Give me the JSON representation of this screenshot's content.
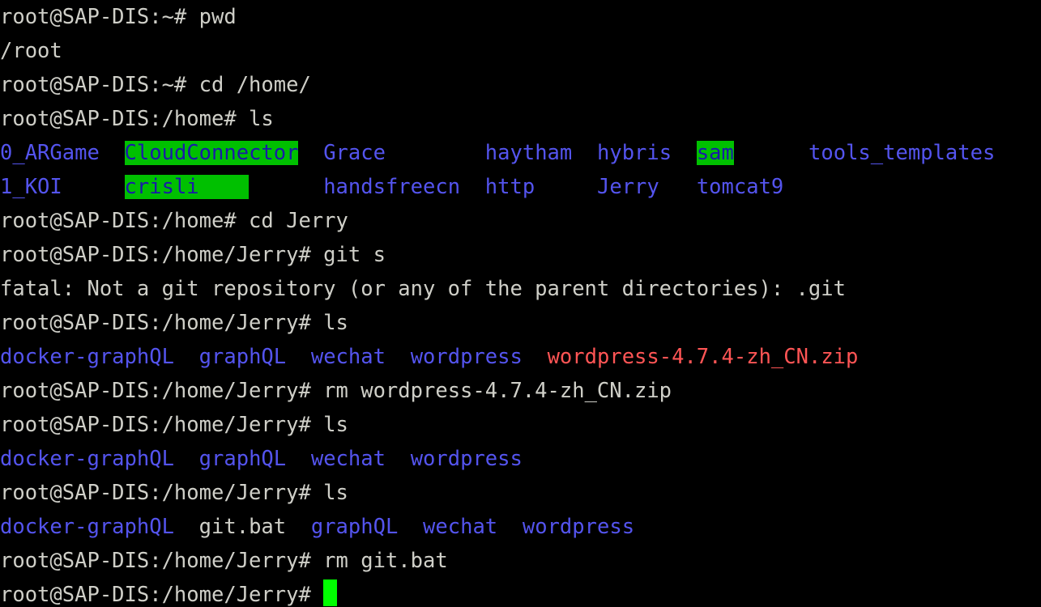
{
  "terminal": {
    "app": "bash-terminal",
    "columns": 81,
    "rows": 18,
    "colors": {
      "background": "#000000",
      "default_text": "#cfcfc8",
      "directory": "#5454ee",
      "archive": "#ff5555",
      "sticky_other_writable_bg": "#00c000",
      "sticky_other_writable_fg": "#1a1aa8",
      "cursor": "#00ff00"
    },
    "prompts": {
      "home": "root@SAP-DIS:~# ",
      "home_dir": "root@SAP-DIS:/home# ",
      "jerry_dir": "root@SAP-DIS:/home/Jerry# "
    },
    "lines": [
      {
        "id": "line-1",
        "kind": "prompt-command",
        "prompt": "root@SAP-DIS:~# ",
        "command": "pwd"
      },
      {
        "id": "line-2",
        "kind": "output",
        "text": "/root"
      },
      {
        "id": "line-3",
        "kind": "prompt-command",
        "prompt": "root@SAP-DIS:~# ",
        "command": "cd /home/"
      },
      {
        "id": "line-4",
        "kind": "prompt-command",
        "prompt": "root@SAP-DIS:/home# ",
        "command": "ls"
      },
      {
        "id": "line-5",
        "kind": "ls-row",
        "entries": [
          {
            "name": "0_ARGame",
            "type": "directory",
            "pad": 2
          },
          {
            "name": "CloudConnector",
            "type": "sticky",
            "pad": 2
          },
          {
            "name": "Grace",
            "type": "directory",
            "pad": 8
          },
          {
            "name": "haytham",
            "type": "directory",
            "pad": 2
          },
          {
            "name": "hybris",
            "type": "directory",
            "pad": 2
          },
          {
            "name": "sam",
            "type": "sticky",
            "pad": 6
          },
          {
            "name": "tools_templates",
            "type": "directory",
            "pad": 0
          }
        ]
      },
      {
        "id": "line-6",
        "kind": "ls-row",
        "entries": [
          {
            "name": "1_KOI",
            "type": "directory",
            "pad": 5
          },
          {
            "name": "crisli",
            "type": "sticky",
            "pad": 10,
            "highlight_pad": 4
          },
          {
            "name": "handsfreecn",
            "type": "directory",
            "pad": 2
          },
          {
            "name": "http",
            "type": "directory",
            "pad": 5
          },
          {
            "name": "Jerry",
            "type": "directory",
            "pad": 3
          },
          {
            "name": "tomcat9",
            "type": "directory",
            "pad": 0
          }
        ]
      },
      {
        "id": "line-7",
        "kind": "prompt-command",
        "prompt": "root@SAP-DIS:/home# ",
        "command": "cd Jerry"
      },
      {
        "id": "line-8",
        "kind": "prompt-command",
        "prompt": "root@SAP-DIS:/home/Jerry# ",
        "command": "git s"
      },
      {
        "id": "line-9",
        "kind": "output",
        "text": "fatal: Not a git repository (or any of the parent directories): .git"
      },
      {
        "id": "line-10",
        "kind": "prompt-command",
        "prompt": "root@SAP-DIS:/home/Jerry# ",
        "command": "ls"
      },
      {
        "id": "line-11",
        "kind": "ls-row",
        "entries": [
          {
            "name": "docker-graphQL",
            "type": "directory",
            "pad": 2
          },
          {
            "name": "graphQL",
            "type": "directory",
            "pad": 2
          },
          {
            "name": "wechat",
            "type": "directory",
            "pad": 2
          },
          {
            "name": "wordpress",
            "type": "directory",
            "pad": 2
          },
          {
            "name": "wordpress-4.7.4-zh_CN.zip",
            "type": "archive",
            "pad": 0
          }
        ]
      },
      {
        "id": "line-12",
        "kind": "prompt-command",
        "prompt": "root@SAP-DIS:/home/Jerry# ",
        "command": "rm wordpress-4.7.4-zh_CN.zip"
      },
      {
        "id": "line-13",
        "kind": "prompt-command",
        "prompt": "root@SAP-DIS:/home/Jerry# ",
        "command": "ls"
      },
      {
        "id": "line-14",
        "kind": "ls-row",
        "entries": [
          {
            "name": "docker-graphQL",
            "type": "directory",
            "pad": 2
          },
          {
            "name": "graphQL",
            "type": "directory",
            "pad": 2
          },
          {
            "name": "wechat",
            "type": "directory",
            "pad": 2
          },
          {
            "name": "wordpress",
            "type": "directory",
            "pad": 0
          }
        ]
      },
      {
        "id": "line-15",
        "kind": "prompt-command",
        "prompt": "root@SAP-DIS:/home/Jerry# ",
        "command": "ls"
      },
      {
        "id": "line-16",
        "kind": "ls-row",
        "entries": [
          {
            "name": "docker-graphQL",
            "type": "directory",
            "pad": 2
          },
          {
            "name": "git.bat",
            "type": "file",
            "pad": 2
          },
          {
            "name": "graphQL",
            "type": "directory",
            "pad": 2
          },
          {
            "name": "wechat",
            "type": "directory",
            "pad": 2
          },
          {
            "name": "wordpress",
            "type": "directory",
            "pad": 0
          }
        ]
      },
      {
        "id": "line-17",
        "kind": "prompt-command",
        "prompt": "root@SAP-DIS:/home/Jerry# ",
        "command": "rm git.bat"
      },
      {
        "id": "line-18",
        "kind": "prompt-cursor",
        "prompt": "root@SAP-DIS:/home/Jerry# ",
        "command": ""
      }
    ]
  }
}
